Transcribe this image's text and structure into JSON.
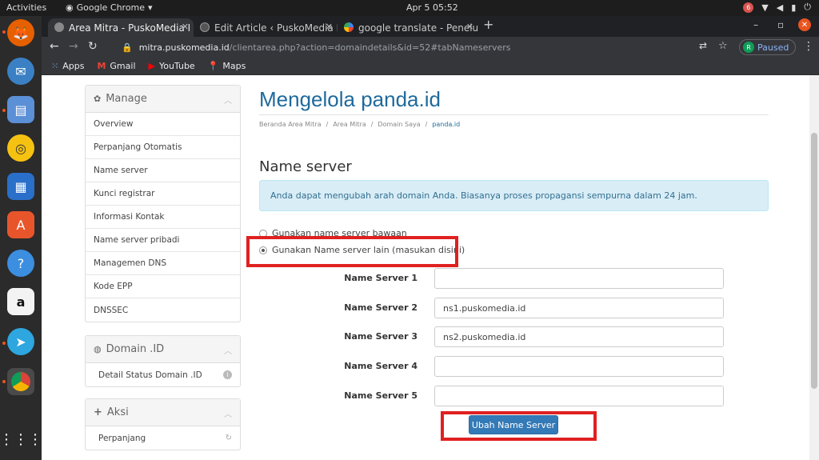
{
  "os": {
    "activities": "Activities",
    "app_menu": "Google Chrome",
    "clock": "Apr 5  05:52",
    "notification_count": "6"
  },
  "browser": {
    "tabs": [
      {
        "label": "Area Mitra - PuskoMedia I",
        "active": true
      },
      {
        "label": "Edit Article ‹ PuskoMedia I",
        "active": false
      },
      {
        "label": "google translate - Penelus",
        "active": false
      }
    ],
    "url_domain": "mitra.puskomedia.id",
    "url_path": "/clientarea.php?action=domaindetails&id=52#tabNameservers",
    "profile_initial": "R",
    "profile_status": "Paused",
    "bookmarks": [
      "Apps",
      "Gmail",
      "YouTube",
      "Maps"
    ]
  },
  "sidebar": {
    "manage": {
      "title": "Manage",
      "items": [
        "Overview",
        "Perpanjang Otomatis",
        "Name server",
        "Kunci registrar",
        "Informasi Kontak",
        "Name server pribadi",
        "Managemen DNS",
        "Kode EPP",
        "DNSSEC"
      ]
    },
    "domain_id": {
      "title": "Domain .ID",
      "items": [
        "Detail Status Domain .ID"
      ]
    },
    "aksi": {
      "title": "Aksi",
      "items": [
        "Perpanjang"
      ]
    }
  },
  "main": {
    "title": "Mengelola panda.id",
    "breadcrumb": [
      "Beranda Area Mitra",
      "Area Mitra",
      "Domain Saya",
      "panda.id"
    ],
    "section_title": "Name server",
    "info_text": "Anda dapat mengubah arah domain Anda. Biasanya proses propagansi sempurna dalam 24 jam.",
    "radio_default": "Gunakan name server bawaan",
    "radio_custom": "Gunakan Name server lain (masukan disini)",
    "nameservers": [
      {
        "label": "Name Server 1",
        "value": ""
      },
      {
        "label": "Name Server 2",
        "value": "ns1.puskomedia.id"
      },
      {
        "label": "Name Server 3",
        "value": "ns2.puskomedia.id"
      },
      {
        "label": "Name Server 4",
        "value": ""
      },
      {
        "label": "Name Server 5",
        "value": ""
      }
    ],
    "submit_label": "Ubah Name Server"
  },
  "colors": {
    "accent": "#337ab7",
    "title": "#1f6a9c",
    "highlight": "#e02020",
    "info_bg": "#d9edf7"
  }
}
